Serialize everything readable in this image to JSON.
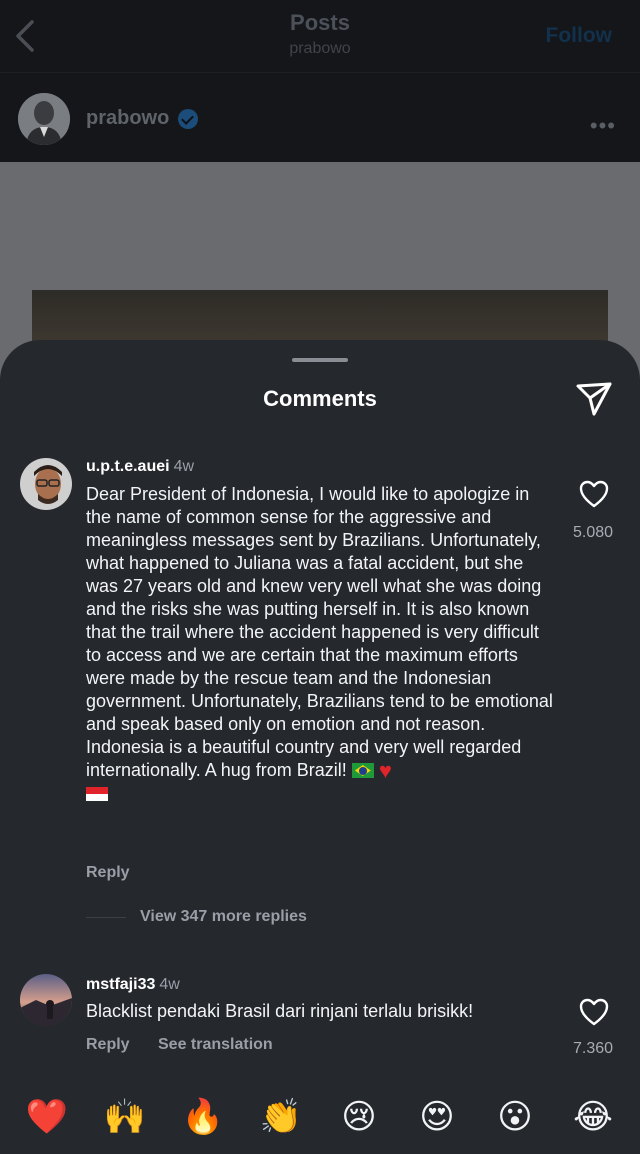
{
  "header": {
    "title": "Posts",
    "subtitle": "prabowo",
    "follow_label": "Follow",
    "back_icon": "chevron-left-icon"
  },
  "author": {
    "username": "prabowo",
    "verified_icon": "verified-badge-icon",
    "more_icon": "more-dots-icon",
    "more_label": "•••"
  },
  "sheet": {
    "title": "Comments",
    "send_icon": "send-icon"
  },
  "comments": [
    {
      "username": "u.p.t.e.auei",
      "time": "4w",
      "text": "Dear President of Indonesia, I would like to apologize in the name of common sense for the aggressive and meaningless messages sent by Brazilians. Unfortunately, what happened to Juliana was a fatal accident, but she was 27 years old and knew very well what she was doing and the risks she was putting herself in. It is also known that the trail where the accident happened is very difficult to access and we are certain that the maximum efforts were made by the rescue team and the Indonesian government. Unfortunately, Brazilians tend to be emotional and speak based only on emotion and not reason. Indonesia is a beautiful country and very well regarded internationally. A hug from Brazil!",
      "text_emojis": [
        "flag-brazil",
        "red-heart",
        "flag-indonesia"
      ],
      "likes": "5.080",
      "reply_label": "Reply",
      "view_replies_label": "View 347 more replies"
    },
    {
      "username": "mstfaji33",
      "time": "4w",
      "text": "Blacklist pendaki Brasil dari rinjani terlalu brisikk!",
      "likes": "7.360",
      "reply_label": "Reply",
      "translate_label": "See translation"
    }
  ],
  "reactions": [
    {
      "name": "red-heart",
      "glyph": "❤️"
    },
    {
      "name": "raising-hands",
      "glyph": "🙌"
    },
    {
      "name": "fire",
      "glyph": "🔥"
    },
    {
      "name": "clapping-hands",
      "glyph": "👏"
    },
    {
      "name": "crying-face",
      "glyph": "😢"
    },
    {
      "name": "heart-eyes",
      "glyph": "😍"
    },
    {
      "name": "surprised-face",
      "glyph": "😮"
    },
    {
      "name": "tears-of-joy",
      "glyph": "😂"
    }
  ]
}
